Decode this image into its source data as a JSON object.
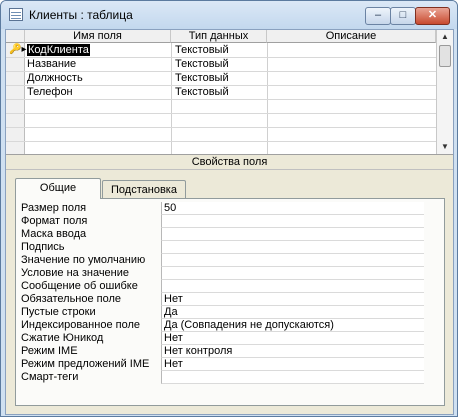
{
  "window": {
    "title": "Клиенты : таблица"
  },
  "titlebar_buttons": {
    "minimize": "–",
    "maximize": "□",
    "close": "✕"
  },
  "grid": {
    "headers": [
      "Имя поля",
      "Тип данных",
      "Описание"
    ],
    "rows": [
      {
        "name": "КодКлиента",
        "type": "Текстовый",
        "desc": "",
        "key": true
      },
      {
        "name": "Название",
        "type": "Текстовый",
        "desc": ""
      },
      {
        "name": "Должность",
        "type": "Текстовый",
        "desc": ""
      },
      {
        "name": "Телефон",
        "type": "Текстовый",
        "desc": ""
      }
    ],
    "key_icon": "key-icon"
  },
  "properties": {
    "header": "Свойства поля",
    "tabs": [
      "Общие",
      "Подстановка"
    ],
    "active_tab": "Общие",
    "rows": [
      {
        "label": "Размер поля",
        "value": "50"
      },
      {
        "label": "Формат поля",
        "value": ""
      },
      {
        "label": "Маска ввода",
        "value": ""
      },
      {
        "label": "Подпись",
        "value": ""
      },
      {
        "label": "Значение по умолчанию",
        "value": ""
      },
      {
        "label": "Условие на значение",
        "value": ""
      },
      {
        "label": "Сообщение об ошибке",
        "value": ""
      },
      {
        "label": "Обязательное поле",
        "value": "Нет"
      },
      {
        "label": "Пустые строки",
        "value": "Да"
      },
      {
        "label": "Индексированное поле",
        "value": "Да (Совпадения не допускаются)"
      },
      {
        "label": "Сжатие Юникод",
        "value": "Нет"
      },
      {
        "label": "Режим IME",
        "value": "Нет контроля"
      },
      {
        "label": "Режим предложений IME",
        "value": "Нет"
      },
      {
        "label": "Смарт-теги",
        "value": ""
      }
    ]
  }
}
